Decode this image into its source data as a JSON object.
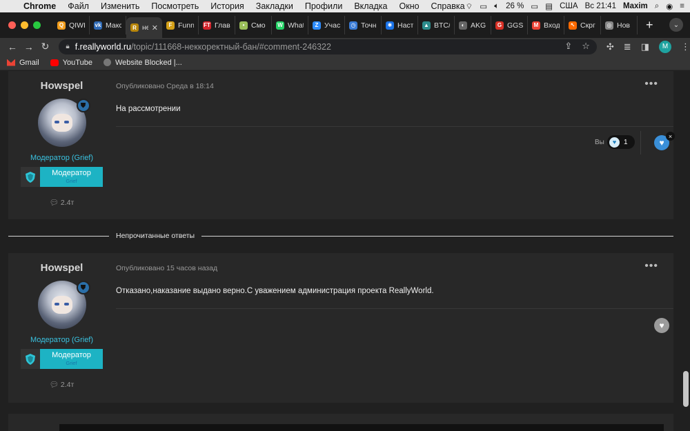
{
  "menubar": {
    "app": "Chrome",
    "items": [
      "Файл",
      "Изменить",
      "Посмотреть",
      "История",
      "Закладки",
      "Профили",
      "Вкладка",
      "Окно",
      "Справка"
    ],
    "battery": "26 %",
    "layout": "США",
    "clock": "Вс 21:41",
    "user": "Maxim"
  },
  "tabs": [
    {
      "label": "QIWI",
      "fav_color": "#f29d1c",
      "fav_glyph": "Q"
    },
    {
      "label": "Макс",
      "fav_color": "#2f6ab5",
      "fav_glyph": "vk"
    },
    {
      "label": "не",
      "fav_color": "#b8860b",
      "fav_glyph": "R",
      "active": true
    },
    {
      "label": "Funn",
      "fav_color": "#d4a017",
      "fav_glyph": "F"
    },
    {
      "label": "Глав",
      "fav_color": "#d3242b",
      "fav_glyph": "FT"
    },
    {
      "label": "Смо",
      "fav_color": "#9bbf5a",
      "fav_glyph": "•"
    },
    {
      "label": "What",
      "fav_color": "#25d366",
      "fav_glyph": "W"
    },
    {
      "label": "Учас",
      "fav_color": "#2d8cff",
      "fav_glyph": "Z"
    },
    {
      "label": "Точн",
      "fav_color": "#3a7bd5",
      "fav_glyph": "◷"
    },
    {
      "label": "Наст",
      "fav_color": "#1a73e8",
      "fav_glyph": "✱"
    },
    {
      "label": "BTC/",
      "fav_color": "#2c8c8c",
      "fav_glyph": "▲"
    },
    {
      "label": "AKG",
      "fav_color": "#666666",
      "fav_glyph": "◐"
    },
    {
      "label": "GGS",
      "fav_color": "#d93025",
      "fav_glyph": "G"
    },
    {
      "label": "Вход",
      "fav_color": "#ea4335",
      "fav_glyph": "M"
    },
    {
      "label": "Скрг",
      "fav_color": "#ff6a00",
      "fav_glyph": "↖"
    },
    {
      "label": "Нов",
      "fav_color": "#888888",
      "fav_glyph": "◎"
    }
  ],
  "address": {
    "host": "f.reallyworld.ru",
    "path": "/topic/111668-неккоректный-бан/#comment-246322"
  },
  "profile_initial": "M",
  "bookmarks": [
    {
      "label": "Gmail",
      "color": "#ea4335"
    },
    {
      "label": "YouTube",
      "color": "#ff0000"
    },
    {
      "label": "Website Blocked |...",
      "color": "#777777"
    }
  ],
  "posts": [
    {
      "author": "Howspel",
      "role": "Модератор (Grief)",
      "badge_title": "Модератор",
      "badge_sub": "Grief",
      "stat": "2.4т",
      "meta": "Опубликовано Среда в 18:14",
      "text": "На рассмотрении",
      "you_label": "Вы",
      "reaction_count": "1"
    },
    {
      "author": "Howspel",
      "role": "Модератор (Grief)",
      "badge_title": "Модератор",
      "badge_sub": "Grief",
      "stat": "2.4т",
      "meta": "Опубликовано 15 часов назад",
      "text": "Отказано,наказание выдано верно.С уважением администрация проекта ReallyWorld."
    }
  ],
  "unread_label": "Непрочитанные ответы",
  "colors": {
    "accent_role": "#3ac2e0",
    "badge": "#1db3c4",
    "reaction_blue": "#3a8fd8"
  }
}
